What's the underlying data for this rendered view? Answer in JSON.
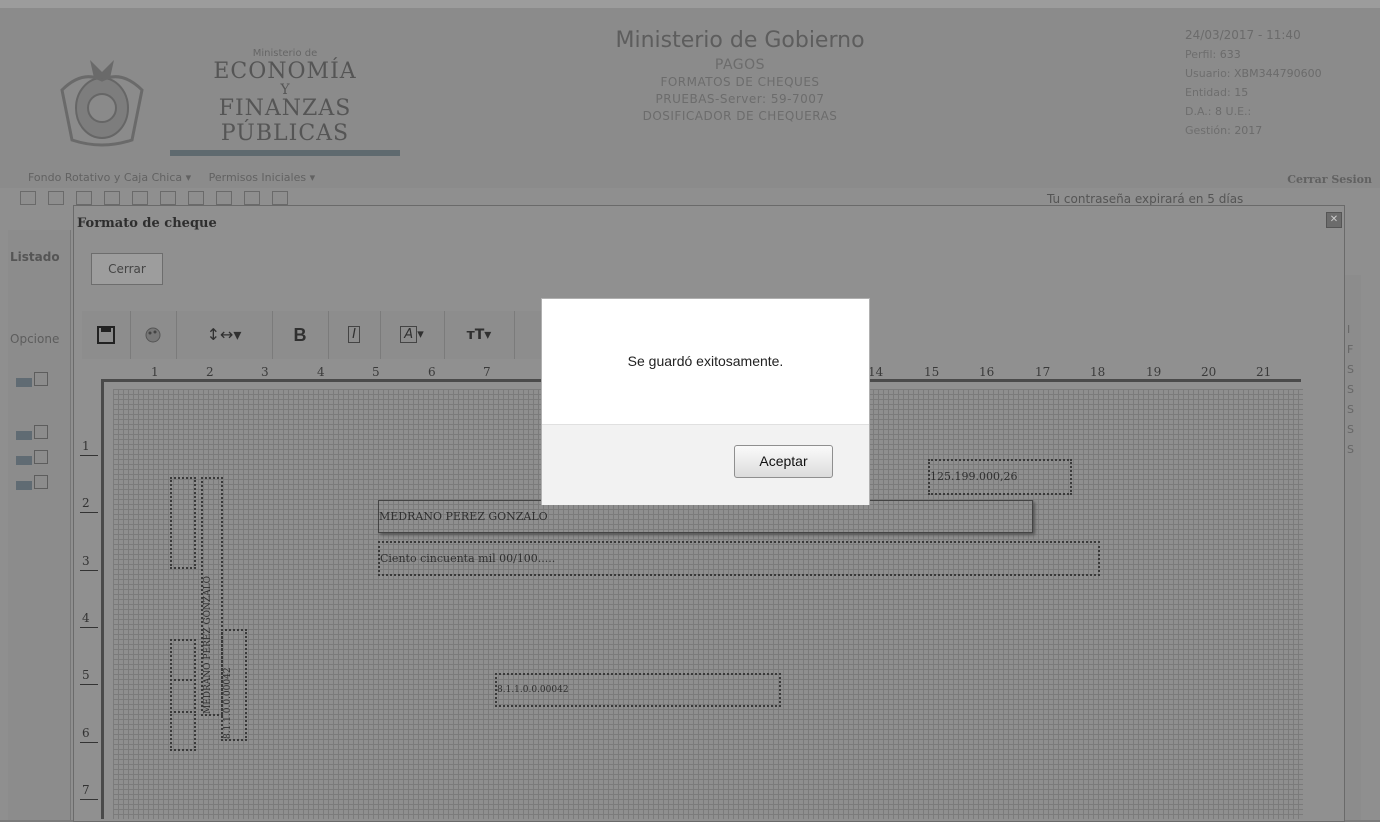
{
  "header": {
    "logo": {
      "small": "Ministerio de",
      "line1": "ECONOMÍA",
      "line2": "Y",
      "line3": "FINANZAS PÚBLICAS"
    },
    "title": "Ministerio de Gobierno",
    "sub1": "PAGOS",
    "sub2": "FORMATOS DE CHEQUES",
    "sub3": "PRUEBAS-Server: 59-7007",
    "sub4": "DOSIFICADOR DE CHEQUERAS",
    "datetime": "24/03/2017 - 11:40",
    "perfil_label": "Perfil:",
    "perfil": "633",
    "usuario_label": "Usuario:",
    "usuario": "XBM344790600",
    "entidad_label": "Entidad:",
    "entidad": "15",
    "da_label": "D.A.:",
    "da": "8",
    "ue_label": "U.E.:",
    "ue": "",
    "gestion_label": "Gestión:",
    "gestion": "2017",
    "logout": "Cerrar Sesion"
  },
  "menu": {
    "item1": "Fondo Rotativo y Caja Chica ▾",
    "item2": "Permisos Iniciales ▾"
  },
  "notice": "Tu contraseña expirará en 5 días",
  "left": {
    "listado": "Listado",
    "opciones": "Opcione"
  },
  "right": {
    "letters": [
      "I",
      "F",
      "S",
      "S",
      "S",
      "S",
      "S"
    ]
  },
  "modal": {
    "title": "Formato de cheque",
    "close_label": "Cerrar",
    "ruler": [
      "1",
      "2",
      "3",
      "4",
      "5",
      "6",
      "7",
      "14",
      "15",
      "16",
      "17",
      "18",
      "19",
      "20",
      "21"
    ],
    "vruler": [
      "1",
      "2",
      "3",
      "4",
      "5",
      "6",
      "7"
    ],
    "fields": {
      "amount": "125.199.000,26",
      "payee": "MEDRANO PEREZ GONZALO",
      "words": "Ciento cincuenta mil 00/100.....",
      "code": "8.1.1.0.0.00042",
      "stub_name": "MEDRANO PEREZ GONZALO",
      "stub_code": "8.1.1.0.0.00042"
    }
  },
  "alert": {
    "message": "Se guardó exitosamente.",
    "ok": "Aceptar"
  }
}
